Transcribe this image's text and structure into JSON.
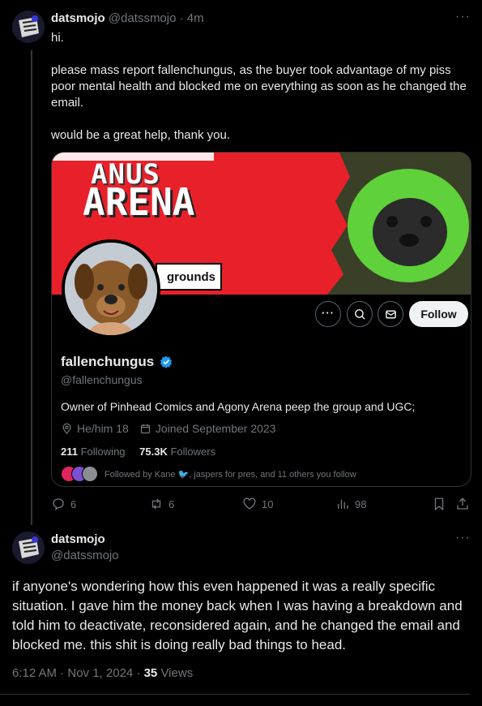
{
  "tweet1": {
    "display_name": "datsmojo",
    "handle": "@datssmojo",
    "time": "· 4m",
    "text": "hi.\n\nplease mass report fallenchungus, as the buyer took advantage of my piss poor mental health and blocked me on everything as soon as he changed the email.\n\nwould be a great help, thank you.",
    "stats": {
      "replies": "6",
      "reposts": "6",
      "likes": "10",
      "views": "98"
    }
  },
  "card": {
    "banner_text_top": "ANUS",
    "banner_text_main": "ARENA",
    "banner_tag": "grounds",
    "follow_label": "Follow",
    "display_name": "fallenchungus",
    "handle": "@fallenchungus",
    "bio": "Owner of Pinhead Comics and Agony Arena peep the group and UGC;",
    "pronouns": "He/him 18",
    "joined": "Joined September 2023",
    "following_count": "211",
    "following_label": "Following",
    "followers_count": "75.3K",
    "followers_label": "Followers",
    "followed_by": "Followed by Kane 🐦, jaspers for pres, and 11 others you follow"
  },
  "tweet2": {
    "display_name": "datsmojo",
    "handle": "@datssmojo",
    "text": "if anyone's wondering how this even happened it was a really specific situation. I gave him the money back when I was having a breakdown and told him to deactivate, reconsidered again, and he changed the email and blocked me. this shit is doing really bad things to head.",
    "timestamp": "6:12 AM · Nov 1, 2024 · ",
    "views_count": "35",
    "views_label": " Views"
  },
  "colors": {
    "accent": "#1d9bf0",
    "banner_red": "#e8202a",
    "verified": "#1d9bf0"
  }
}
